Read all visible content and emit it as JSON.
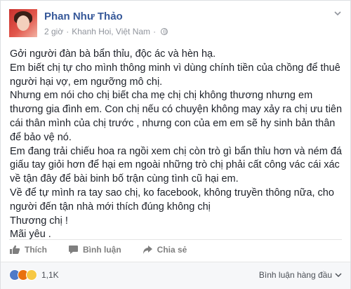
{
  "post": {
    "author": "Phan Như Thảo",
    "time": "2 giờ",
    "location": "Khanh Hoi, Việt Nam",
    "separator": "·",
    "lines": [
      "Gởi người đàn bà bẩn thỉu, độc ác và hèn hạ.",
      "Em biết chị tự cho mình thông minh vì dùng chính tiền của chồng để thuê người hại vợ, em ngưỡng mô chị.",
      "Nhưng em nói cho chị biết cha mẹ chị chị không thương nhưng em thương gia đình em. Con chị nếu có chuyện không may xảy ra chị ưu tiên cái thân mình của chị trước , nhưng con của em em sẽ hy sinh bản thân để bảo vệ nó.",
      "Em đang trải chiếu hoa ra ngồi xem chị còn trò gì bẩn thỉu hơn và ném đá giấu tay giỏi hơn để hại em ngoài những trò chị phải cất công vác cái xác về tận đây để bài binh bố trận cùng tình cũ hại em.",
      "Về để tự mình ra tay sao chị, ko facebook, không truyền thông nữa, cho người đến tận nhà mới thích đúng không chị",
      "Thương chị !",
      "Mãi yêu ."
    ]
  },
  "actions": {
    "like": "Thích",
    "comment": "Bình luận",
    "share": "Chia sẻ"
  },
  "footer": {
    "reaction_count": "1,1K",
    "sort_label": "Bình luận hàng đầu"
  },
  "icons": {
    "avatar": "profile-photo",
    "privacy": "globe-icon",
    "menu": "chevron-down-icon",
    "like": "thumbs-up-icon",
    "comment": "speech-bubble-icon",
    "share": "share-arrow-icon",
    "reactions": [
      "like-reaction-icon",
      "angry-reaction-icon",
      "sad-reaction-icon"
    ]
  },
  "colors": {
    "name": "#365899",
    "meta": "#90949c",
    "text": "#1d2129",
    "action": "#7f7f7f",
    "footer_bg": "#f6f7f9"
  }
}
